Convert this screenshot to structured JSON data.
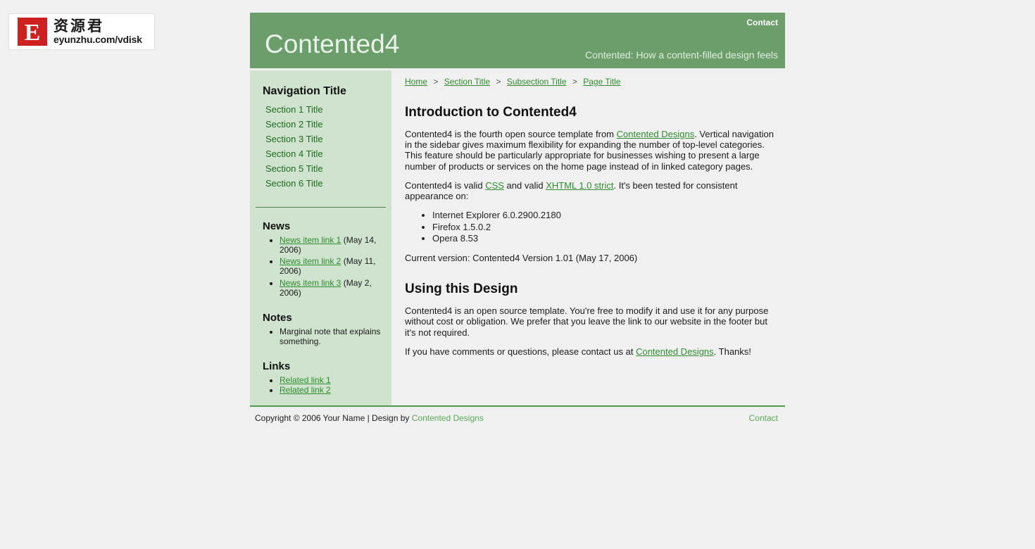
{
  "watermark": {
    "mark_letter": "E",
    "chinese_text": "资源君",
    "url_text": "eyunzhu.com/vdisk"
  },
  "header": {
    "site_title": "Contented4",
    "contact_label": "Contact",
    "tagline": "Contented: How a content-filled design feels",
    "bg_color": "#6b9e6b",
    "title_color": "#e9f3e9"
  },
  "breadcrumb": {
    "separator": ">",
    "items": [
      {
        "label": "Home"
      },
      {
        "label": "Section Title"
      },
      {
        "label": "Subsection Title"
      },
      {
        "label": "Page Title"
      }
    ]
  },
  "sidebar": {
    "nav_title": "Navigation Title",
    "nav_items": [
      {
        "label": "Section 1 Title"
      },
      {
        "label": "Section 2 Title"
      },
      {
        "label": "Section 3 Title"
      },
      {
        "label": "Section 4 Title"
      },
      {
        "label": "Section 5 Title"
      },
      {
        "label": "Section 6 Title"
      }
    ],
    "news": {
      "heading": "News",
      "items": [
        {
          "link": "News item link 1",
          "date": "(May 14, 2006)"
        },
        {
          "link": "News item link 2",
          "date": "(May 11, 2006)"
        },
        {
          "link": "News item link 3",
          "date": "(May 2, 2006)"
        }
      ]
    },
    "notes": {
      "heading": "Notes",
      "items": [
        {
          "text": "Marginal note that explains something."
        }
      ]
    },
    "links": {
      "heading": "Links",
      "items": [
        {
          "label": "Related link 1"
        },
        {
          "label": "Related link 2"
        }
      ]
    },
    "bg_color": "#cfe3cf",
    "link_color": "#1d6b1d"
  },
  "main": {
    "heading_1": "Introduction to Contented4",
    "para_1": {
      "before_link": "Contented4 is the fourth open source template from ",
      "link": "Contented Designs",
      "after_link": ". Vertical navigation in the sidebar gives maximum flexibility for expanding the number of top-level categories. This feature should be particularly appropriate for businesses wishing to present a large number of products or services on the home page instead of in linked category pages."
    },
    "para_2": {
      "part_1": "Contented4 is valid ",
      "link_1": "CSS",
      "part_2": " and valid ",
      "link_2": "XHTML 1.0 strict",
      "part_3": ". It's been tested for consistent appearance on:"
    },
    "browsers": [
      {
        "label": "Internet Explorer 6.0.2900.2180"
      },
      {
        "label": "Firefox 1.5.0.2"
      },
      {
        "label": "Opera 8.53"
      }
    ],
    "version_line": "Current version: Contented4 Version 1.01 (May 17, 2006)",
    "heading_2": "Using this Design",
    "para_3": "Contented4 is an open source template. You're free to modify it and use it for any purpose without cost or obligation. We prefer that you leave the link to our website in the footer but it's not required.",
    "para_4": {
      "before_link": "If you have comments or questions, please contact us at ",
      "link": "Contented Designs",
      "after_link": ". Thanks!"
    }
  },
  "footer": {
    "copyright_text": "Copyright © 2006 Your Name | Design by ",
    "designer_link": "Contented Designs",
    "contact_label": "Contact",
    "link_color": "#55aa55"
  }
}
